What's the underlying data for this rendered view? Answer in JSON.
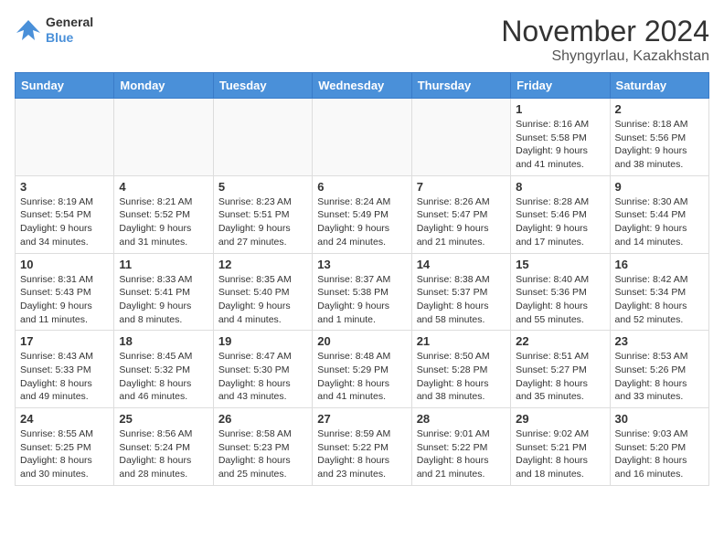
{
  "header": {
    "logo": {
      "general": "General",
      "blue": "Blue"
    },
    "title": "November 2024",
    "location": "Shyngyrlau, Kazakhstan"
  },
  "weekdays": [
    "Sunday",
    "Monday",
    "Tuesday",
    "Wednesday",
    "Thursday",
    "Friday",
    "Saturday"
  ],
  "weeks": [
    [
      {
        "day": null
      },
      {
        "day": null
      },
      {
        "day": null
      },
      {
        "day": null
      },
      {
        "day": null
      },
      {
        "day": 1,
        "sunrise": "8:16 AM",
        "sunset": "5:58 PM",
        "daylight": "9 hours and 41 minutes."
      },
      {
        "day": 2,
        "sunrise": "8:18 AM",
        "sunset": "5:56 PM",
        "daylight": "9 hours and 38 minutes."
      }
    ],
    [
      {
        "day": 3,
        "sunrise": "8:19 AM",
        "sunset": "5:54 PM",
        "daylight": "9 hours and 34 minutes."
      },
      {
        "day": 4,
        "sunrise": "8:21 AM",
        "sunset": "5:52 PM",
        "daylight": "9 hours and 31 minutes."
      },
      {
        "day": 5,
        "sunrise": "8:23 AM",
        "sunset": "5:51 PM",
        "daylight": "9 hours and 27 minutes."
      },
      {
        "day": 6,
        "sunrise": "8:24 AM",
        "sunset": "5:49 PM",
        "daylight": "9 hours and 24 minutes."
      },
      {
        "day": 7,
        "sunrise": "8:26 AM",
        "sunset": "5:47 PM",
        "daylight": "9 hours and 21 minutes."
      },
      {
        "day": 8,
        "sunrise": "8:28 AM",
        "sunset": "5:46 PM",
        "daylight": "9 hours and 17 minutes."
      },
      {
        "day": 9,
        "sunrise": "8:30 AM",
        "sunset": "5:44 PM",
        "daylight": "9 hours and 14 minutes."
      }
    ],
    [
      {
        "day": 10,
        "sunrise": "8:31 AM",
        "sunset": "5:43 PM",
        "daylight": "9 hours and 11 minutes."
      },
      {
        "day": 11,
        "sunrise": "8:33 AM",
        "sunset": "5:41 PM",
        "daylight": "9 hours and 8 minutes."
      },
      {
        "day": 12,
        "sunrise": "8:35 AM",
        "sunset": "5:40 PM",
        "daylight": "9 hours and 4 minutes."
      },
      {
        "day": 13,
        "sunrise": "8:37 AM",
        "sunset": "5:38 PM",
        "daylight": "9 hours and 1 minute."
      },
      {
        "day": 14,
        "sunrise": "8:38 AM",
        "sunset": "5:37 PM",
        "daylight": "8 hours and 58 minutes."
      },
      {
        "day": 15,
        "sunrise": "8:40 AM",
        "sunset": "5:36 PM",
        "daylight": "8 hours and 55 minutes."
      },
      {
        "day": 16,
        "sunrise": "8:42 AM",
        "sunset": "5:34 PM",
        "daylight": "8 hours and 52 minutes."
      }
    ],
    [
      {
        "day": 17,
        "sunrise": "8:43 AM",
        "sunset": "5:33 PM",
        "daylight": "8 hours and 49 minutes."
      },
      {
        "day": 18,
        "sunrise": "8:45 AM",
        "sunset": "5:32 PM",
        "daylight": "8 hours and 46 minutes."
      },
      {
        "day": 19,
        "sunrise": "8:47 AM",
        "sunset": "5:30 PM",
        "daylight": "8 hours and 43 minutes."
      },
      {
        "day": 20,
        "sunrise": "8:48 AM",
        "sunset": "5:29 PM",
        "daylight": "8 hours and 41 minutes."
      },
      {
        "day": 21,
        "sunrise": "8:50 AM",
        "sunset": "5:28 PM",
        "daylight": "8 hours and 38 minutes."
      },
      {
        "day": 22,
        "sunrise": "8:51 AM",
        "sunset": "5:27 PM",
        "daylight": "8 hours and 35 minutes."
      },
      {
        "day": 23,
        "sunrise": "8:53 AM",
        "sunset": "5:26 PM",
        "daylight": "8 hours and 33 minutes."
      }
    ],
    [
      {
        "day": 24,
        "sunrise": "8:55 AM",
        "sunset": "5:25 PM",
        "daylight": "8 hours and 30 minutes."
      },
      {
        "day": 25,
        "sunrise": "8:56 AM",
        "sunset": "5:24 PM",
        "daylight": "8 hours and 28 minutes."
      },
      {
        "day": 26,
        "sunrise": "8:58 AM",
        "sunset": "5:23 PM",
        "daylight": "8 hours and 25 minutes."
      },
      {
        "day": 27,
        "sunrise": "8:59 AM",
        "sunset": "5:22 PM",
        "daylight": "8 hours and 23 minutes."
      },
      {
        "day": 28,
        "sunrise": "9:01 AM",
        "sunset": "5:22 PM",
        "daylight": "8 hours and 21 minutes."
      },
      {
        "day": 29,
        "sunrise": "9:02 AM",
        "sunset": "5:21 PM",
        "daylight": "8 hours and 18 minutes."
      },
      {
        "day": 30,
        "sunrise": "9:03 AM",
        "sunset": "5:20 PM",
        "daylight": "8 hours and 16 minutes."
      }
    ]
  ]
}
